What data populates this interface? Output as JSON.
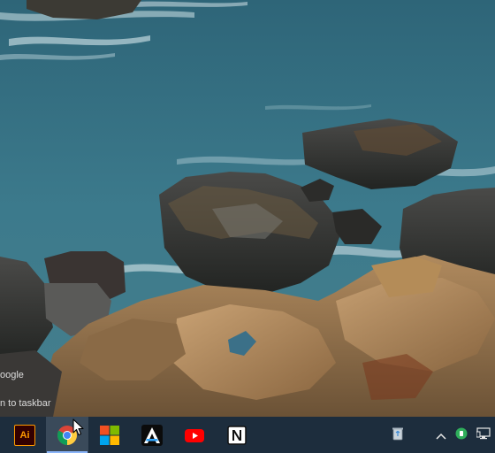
{
  "desktop": {
    "jumplist_title_fragment": "oogle",
    "jumplist_pin_fragment": "n to taskbar"
  },
  "taskbar": {
    "apps": [
      {
        "name": "Adobe Illustrator",
        "icon": "illustrator-icon",
        "label": "Ai",
        "active": false
      },
      {
        "name": "Google Chrome",
        "icon": "chrome-icon",
        "active": true
      },
      {
        "name": "Microsoft Store",
        "icon": "microsoft-store-icon",
        "active": false
      },
      {
        "name": "Arc",
        "icon": "arc-icon",
        "active": false
      },
      {
        "name": "YouTube",
        "icon": "youtube-icon",
        "active": false
      },
      {
        "name": "Notion",
        "icon": "notion-icon",
        "active": false
      }
    ],
    "tray": {
      "icons": [
        "recycle-bin-icon",
        "chevron-up-icon",
        "status-icon",
        "network-icon"
      ]
    }
  },
  "colors": {
    "taskbar_bg": "#1d2d3d",
    "active_app_bg": "#3a4a5a",
    "active_indicator": "#8ab4f8",
    "illustrator_orange": "#ff9a00",
    "youtube_red": "#ff0000"
  }
}
